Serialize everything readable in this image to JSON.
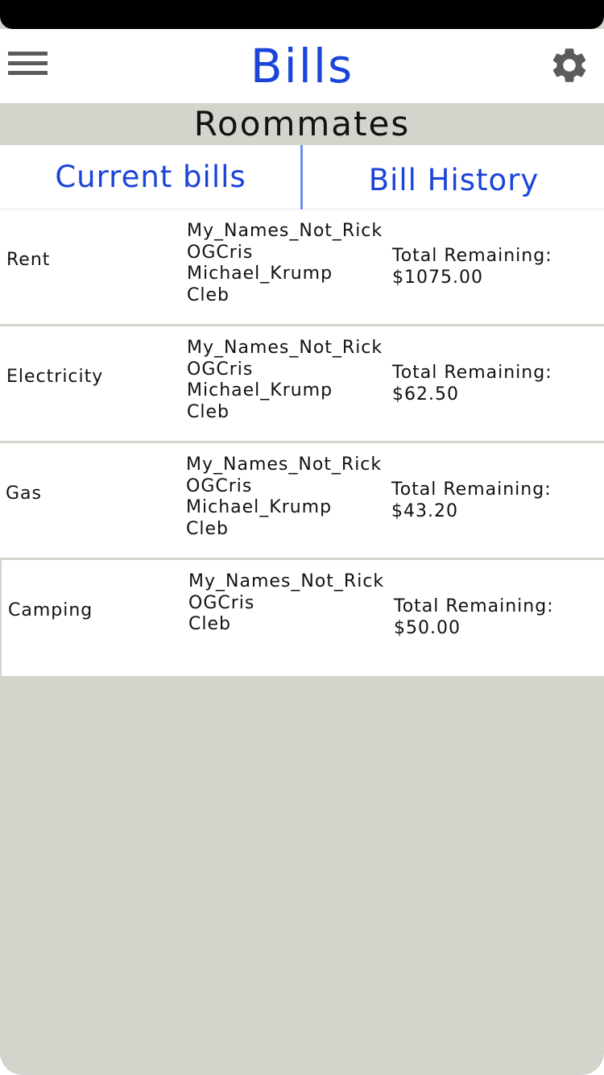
{
  "header": {
    "title": "Bills",
    "menu_icon": "hamburger-menu-icon",
    "settings_icon": "gear-icon"
  },
  "group": {
    "name": "Roommates"
  },
  "tabs": [
    {
      "label": "Current bills"
    },
    {
      "label": "Bill History"
    }
  ],
  "bills": [
    {
      "name": "Rent",
      "members": [
        "My_Names_Not_Rick",
        "OGCris",
        "Michael_Krump",
        "Cleb"
      ],
      "total_label": "Total Remaining:",
      "amount": "$1075.00"
    },
    {
      "name": "Electricity",
      "members": [
        "My_Names_Not_Rick",
        "OGCris",
        "Michael_Krump",
        "Cleb"
      ],
      "total_label": "Total Remaining:",
      "amount": "$62.50"
    },
    {
      "name": "Gas",
      "members": [
        "My_Names_Not_Rick",
        "OGCris",
        "Michael_Krump",
        "Cleb"
      ],
      "total_label": "Total Remaining:",
      "amount": "$43.20"
    },
    {
      "name": "Camping",
      "members": [
        "My_Names_Not_Rick",
        "OGCris",
        "Cleb"
      ],
      "total_label": "Total Remaining:",
      "amount": "$50.00"
    }
  ],
  "colors": {
    "accent": "#1b44d8",
    "background": "#d2d5cc",
    "divider": "#6a8ee6"
  }
}
